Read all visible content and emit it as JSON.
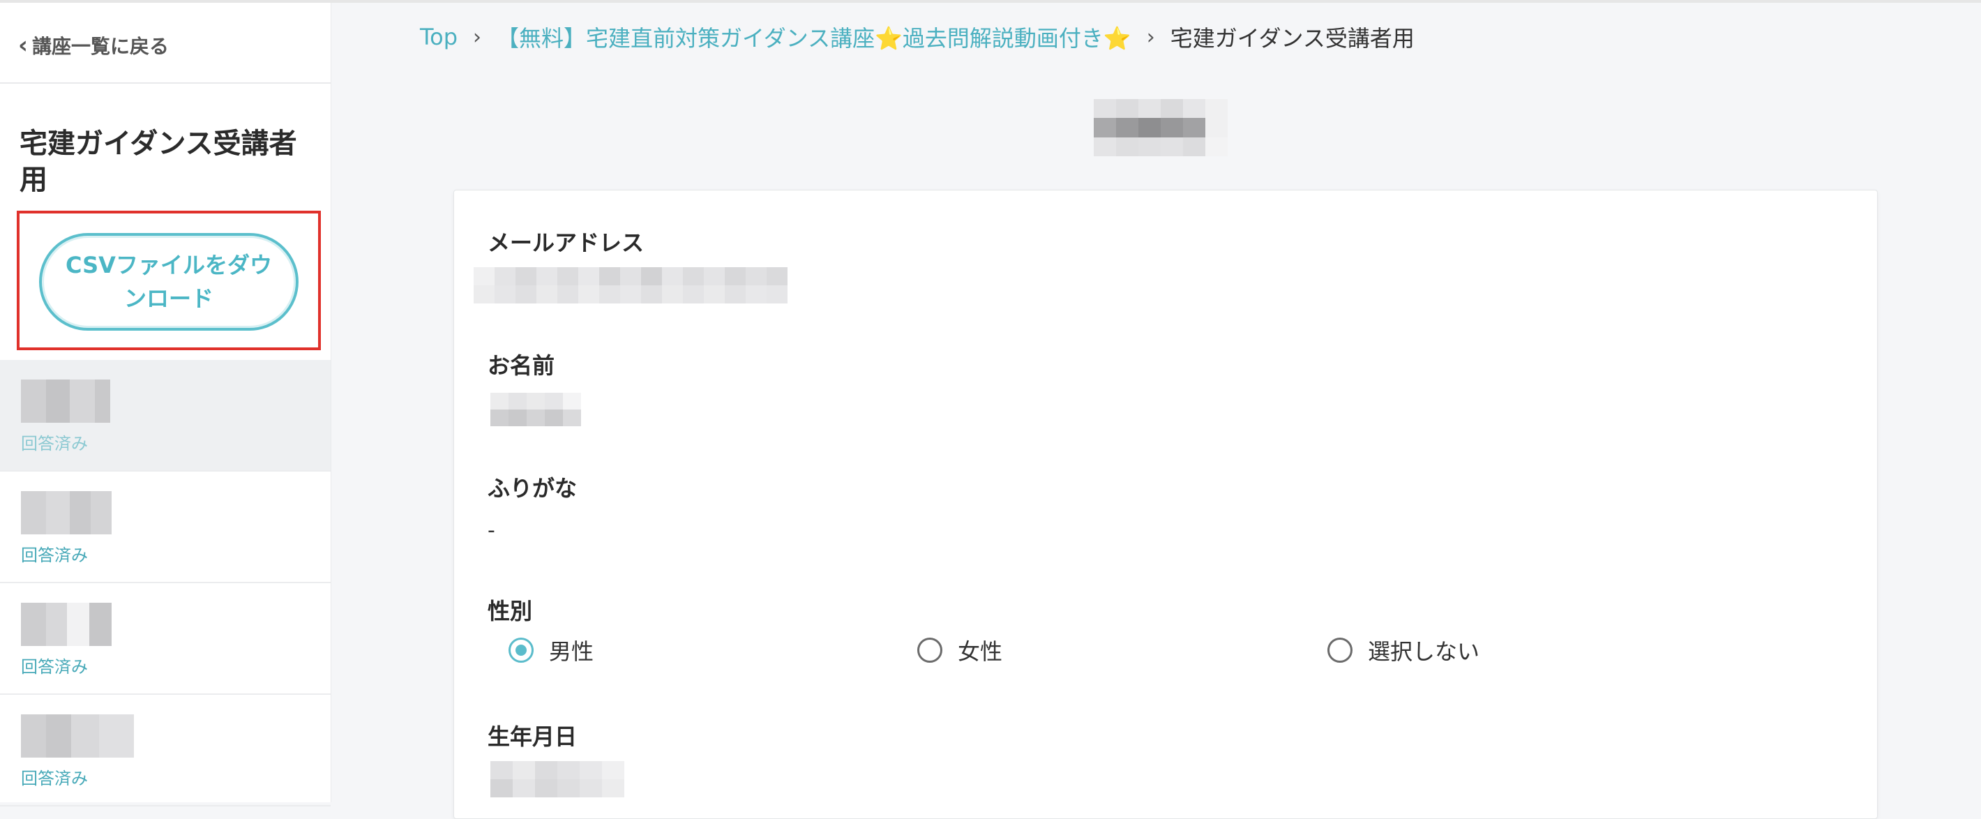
{
  "sidebar": {
    "back_label": "講座一覧に戻る",
    "course_title": "宅建ガイダンス受講者用",
    "csv_button": "CSVファイルをダウンロード",
    "responses": [
      {
        "status": "回答済み"
      },
      {
        "status": "回答済み"
      },
      {
        "status": "回答済み"
      },
      {
        "status": "回答済み"
      }
    ]
  },
  "breadcrumb": {
    "top": "Top",
    "separator": "›",
    "course": "【無料】宅建直前対策ガイダンス講座⭐過去問解説動画付き⭐",
    "current": "宅建ガイダンス受講者用"
  },
  "form": {
    "email_label": "メールアドレス",
    "name_label": "お名前",
    "furigana_label": "ふりがな",
    "furigana_value": "-",
    "gender_label": "性別",
    "gender_options": [
      "男性",
      "女性",
      "選択しない"
    ],
    "gender_selected": "男性",
    "birthday_label": "生年月日"
  },
  "colors": {
    "accent": "#4bb6c5",
    "highlight_frame": "#e0312b",
    "background": "#f5f6f8"
  }
}
